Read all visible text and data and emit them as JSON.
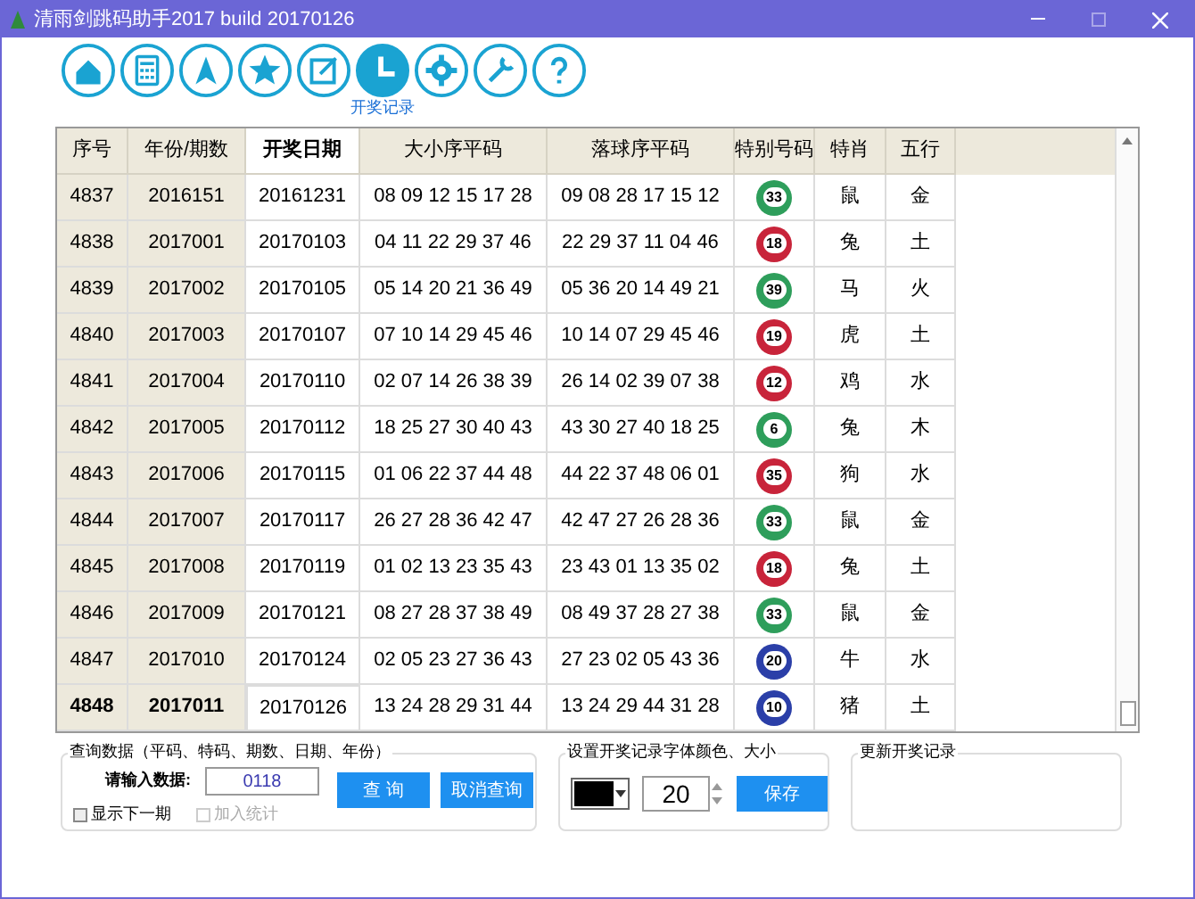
{
  "window": {
    "title": "清雨剑跳码助手2017 build 20170126"
  },
  "toolbar": [
    {
      "selected": false
    },
    {
      "selected": false
    },
    {
      "selected": false
    },
    {
      "selected": false
    },
    {
      "selected": false
    },
    {
      "selected": true,
      "label": "开奖记录"
    },
    {
      "selected": false
    },
    {
      "selected": false
    },
    {
      "selected": false
    }
  ],
  "table": {
    "columns": [
      "序号",
      "年份/期数",
      "开奖日期",
      "大小序平码",
      "落球序平码",
      "特别号码",
      "特肖",
      "五行"
    ],
    "rows": [
      {
        "selected": false,
        "cells": [
          "4837",
          "2016151",
          "20161231",
          "08 09 12 15 17 28",
          "09 08 28 17 15 12"
        ],
        "ball": {
          "text": "33",
          "color": "#2e9e5b"
        },
        "zodiac": "鼠",
        "element": "金"
      },
      {
        "selected": false,
        "cells": [
          "4838",
          "2017001",
          "20170103",
          "04 11 22 29 37 46",
          "22 29 37 11 04 46"
        ],
        "ball": {
          "text": "18",
          "color": "#c8243a"
        },
        "zodiac": "兔",
        "element": "土"
      },
      {
        "selected": false,
        "cells": [
          "4839",
          "2017002",
          "20170105",
          "05 14 20 21 36 49",
          "05 36 20 14 49 21"
        ],
        "ball": {
          "text": "39",
          "color": "#2e9e5b"
        },
        "zodiac": "马",
        "element": "火"
      },
      {
        "selected": false,
        "cells": [
          "4840",
          "2017003",
          "20170107",
          "07 10 14 29 45 46",
          "10 14 07 29 45 46"
        ],
        "ball": {
          "text": "19",
          "color": "#c8243a"
        },
        "zodiac": "虎",
        "element": "土"
      },
      {
        "selected": false,
        "cells": [
          "4841",
          "2017004",
          "20170110",
          "02 07 14 26 38 39",
          "26 14 02 39 07 38"
        ],
        "ball": {
          "text": "12",
          "color": "#c8243a"
        },
        "zodiac": "鸡",
        "element": "水"
      },
      {
        "selected": false,
        "cells": [
          "4842",
          "2017005",
          "20170112",
          "18 25 27 30 40 43",
          "43 30 27 40 18 25"
        ],
        "ball": {
          "text": "6",
          "color": "#2e9e5b"
        },
        "zodiac": "兔",
        "element": "木"
      },
      {
        "selected": false,
        "cells": [
          "4843",
          "2017006",
          "20170115",
          "01 06 22 37 44 48",
          "44 22 37 48 06 01"
        ],
        "ball": {
          "text": "35",
          "color": "#c8243a"
        },
        "zodiac": "狗",
        "element": "水"
      },
      {
        "selected": false,
        "cells": [
          "4844",
          "2017007",
          "20170117",
          "26 27 28 36 42 47",
          "42 47 27 26 28 36"
        ],
        "ball": {
          "text": "33",
          "color": "#2e9e5b"
        },
        "zodiac": "鼠",
        "element": "金"
      },
      {
        "selected": false,
        "cells": [
          "4845",
          "2017008",
          "20170119",
          "01 02 13 23 35 43",
          "23 43 01 13 35 02"
        ],
        "ball": {
          "text": "18",
          "color": "#c8243a"
        },
        "zodiac": "兔",
        "element": "土"
      },
      {
        "selected": false,
        "cells": [
          "4846",
          "2017009",
          "20170121",
          "08 27 28 37 38 49",
          "08 49 37 28 27 38"
        ],
        "ball": {
          "text": "33",
          "color": "#2e9e5b"
        },
        "zodiac": "鼠",
        "element": "金"
      },
      {
        "selected": false,
        "cells": [
          "4847",
          "2017010",
          "20170124",
          "02 05 23 27 36 43",
          "27 23 02 05 43 36"
        ],
        "ball": {
          "text": "20",
          "color": "#2b3fa8"
        },
        "zodiac": "牛",
        "element": "水"
      },
      {
        "selected": true,
        "cells": [
          "4848",
          "2017011",
          "20170126",
          "13 24 28 29 31 44",
          "13 24 29 44 31 28"
        ],
        "ball": {
          "text": "10",
          "color": "#2b3fa8"
        },
        "zodiac": "猪",
        "element": "土"
      }
    ]
  },
  "query": {
    "title": "查询数据（平码、特码、期数、日期、年份）",
    "label": "请输入数据:",
    "value": "0118",
    "show_next": {
      "label": "显示下一期",
      "checked": false
    },
    "add_stats": {
      "label": "加入统计",
      "checked": false,
      "disabled": true
    },
    "buttons": [
      "查 询",
      "取消查询"
    ]
  },
  "font_settings": {
    "title": "设置开奖记录字体颜色、大小",
    "color": "#000000",
    "size": "20",
    "button": "保存"
  },
  "update": {
    "title": "更新开奖记录"
  }
}
